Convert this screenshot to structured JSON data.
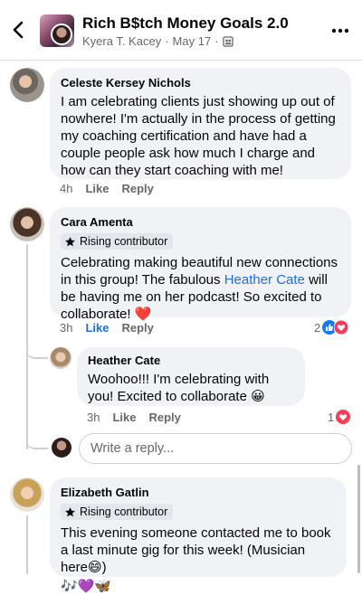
{
  "header": {
    "group_name": "Rich B$tch Money Goals 2.0",
    "author": "Kyera T. Kacey",
    "date": "May 17"
  },
  "comments": [
    {
      "name": "Celeste Kersey Nichols",
      "text": "I am celebrating clients just showing up out of nowhere! I'm actually in the process of getting my coaching certification and have had a couple people ask how much I charge and how can they start coaching with me!",
      "time": "4h",
      "like": "Like",
      "reply": "Reply"
    },
    {
      "name": "Cara Amenta",
      "badge": "Rising contributor",
      "text_before": "Celebrating making beautiful new connections in this group! The fabulous ",
      "mention": "Heather Cate",
      "text_after": " will be having me on her podcast! So excited to collaborate! ",
      "emoji": "❤️",
      "time": "3h",
      "like": "Like",
      "reply": "Reply",
      "reaction_count": "2"
    },
    {
      "name": "Heather Cate",
      "text": "Woohoo!!!  I'm celebrating with you! Excited to collaborate ",
      "emoji": "😀",
      "time": "3h",
      "like": "Like",
      "reply": "Reply",
      "reaction_count": "1"
    },
    {
      "name": "Elizabeth Gatlin",
      "badge": "Rising contributor",
      "text": "This evening someone contacted me to book a last minute gig for this week! (Musician here",
      "emoji_inline": "😄",
      "text_end": ")",
      "emoji_line": "🎶💜🦋"
    }
  ],
  "reply_placeholder": "Write a reply...",
  "colors": {
    "link": "#216fdb",
    "bubble": "#f0f2f5",
    "meta": "#65676b",
    "heart": "#f33e58"
  }
}
